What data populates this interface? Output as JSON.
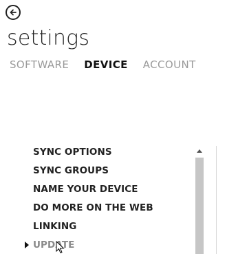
{
  "header": {
    "back_icon": "back-arrow-icon",
    "title": "settings"
  },
  "tabs": [
    {
      "label": "SOFTWARE",
      "active": false
    },
    {
      "label": "DEVICE",
      "active": true
    },
    {
      "label": "ACCOUNT",
      "active": false
    }
  ],
  "menu": {
    "items": [
      {
        "label": "SYNC OPTIONS"
      },
      {
        "label": "SYNC GROUPS"
      },
      {
        "label": "NAME YOUR DEVICE"
      },
      {
        "label": "DO MORE ON THE WEB"
      },
      {
        "label": "LINKING"
      },
      {
        "label": "UPDATE",
        "selected": true
      }
    ]
  },
  "colors": {
    "active_tab": "#111111",
    "inactive_tab": "#9a9a9a",
    "selected_item": "#8a8a8a",
    "scroll_thumb": "#c6c6c6"
  }
}
